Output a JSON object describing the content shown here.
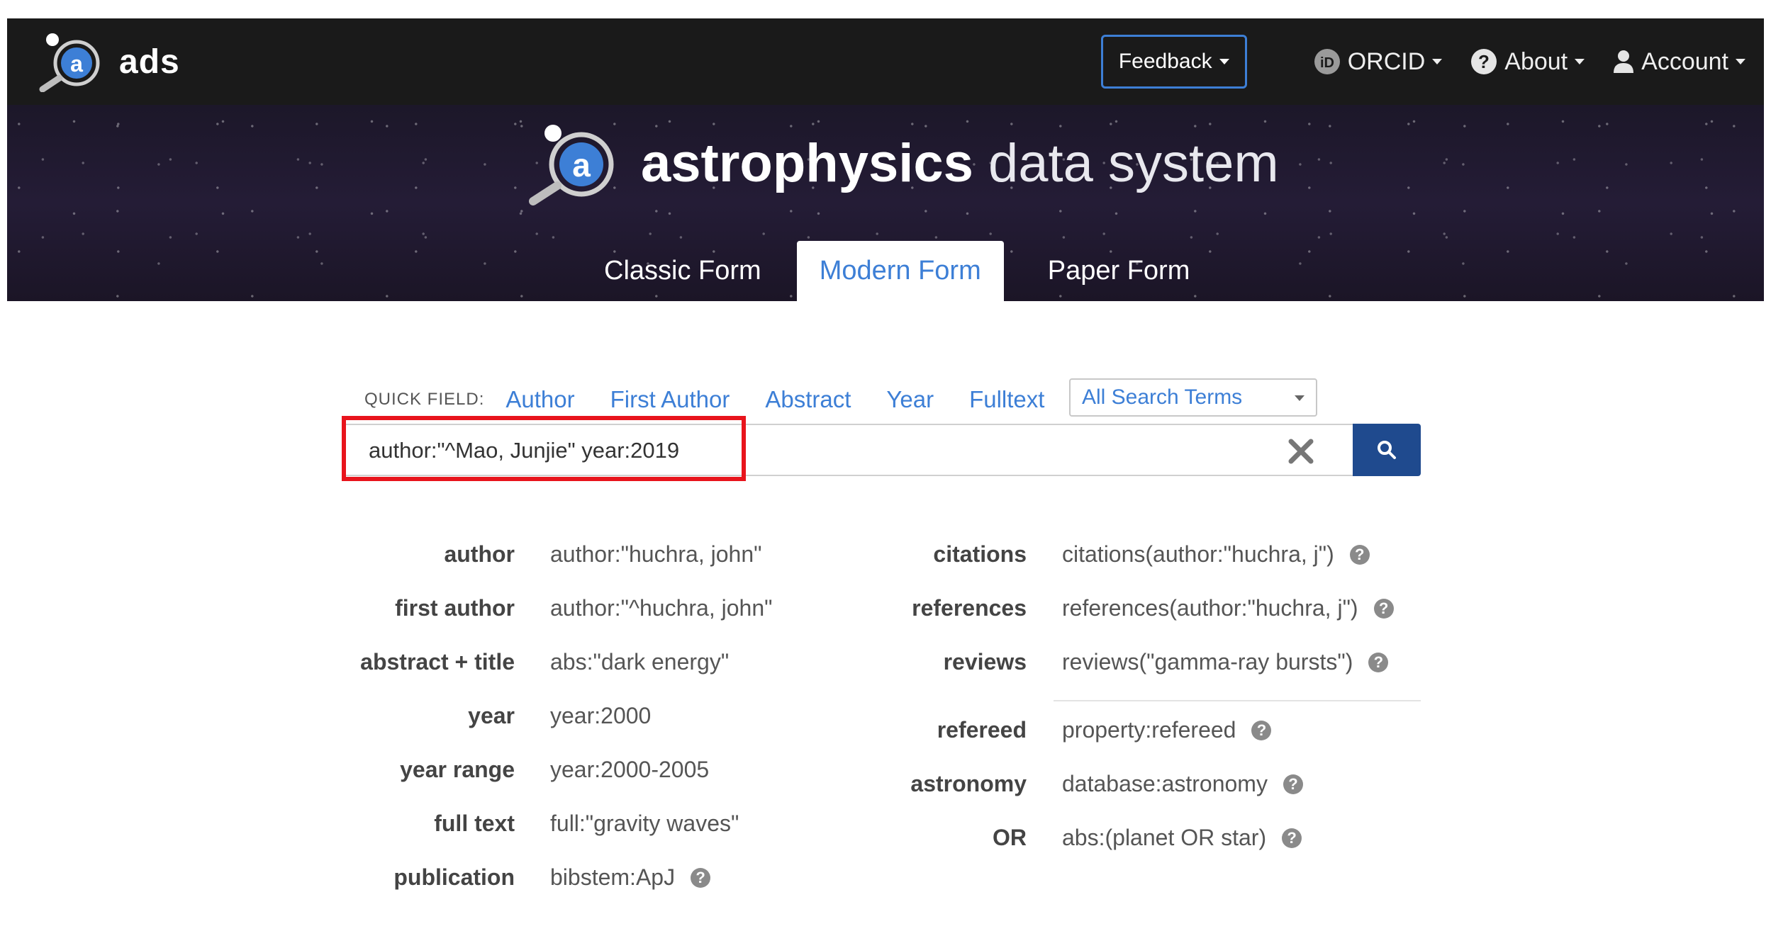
{
  "navbar": {
    "brand": "ads",
    "feedback": "Feedback",
    "orcid": "ORCID",
    "about": "About",
    "account": "Account"
  },
  "hero": {
    "title_bold": "astrophysics",
    "title_light": "data system",
    "tabs": [
      {
        "label": "Classic Form",
        "active": false
      },
      {
        "label": "Modern Form",
        "active": true
      },
      {
        "label": "Paper Form",
        "active": false
      }
    ]
  },
  "quick_field": {
    "label": "QUICK FIELD:",
    "links": [
      "Author",
      "First Author",
      "Abstract",
      "Year",
      "Fulltext"
    ],
    "select_value": "All Search Terms"
  },
  "search": {
    "value": "author:\"^Mao, Junjie\" year:2019"
  },
  "examples_left": [
    {
      "label": "author",
      "value": "author:\"huchra, john\""
    },
    {
      "label": "first author",
      "value": "author:\"^huchra, john\""
    },
    {
      "label": "abstract + title",
      "value": "abs:\"dark energy\""
    },
    {
      "label": "year",
      "value": "year:2000"
    },
    {
      "label": "year range",
      "value": "year:2000-2005"
    },
    {
      "label": "full text",
      "value": "full:\"gravity waves\""
    },
    {
      "label": "publication",
      "value": "bibstem:ApJ"
    }
  ],
  "examples_right": [
    {
      "label": "citations",
      "value": "citations(author:\"huchra, j\")"
    },
    {
      "label": "references",
      "value": "references(author:\"huchra, j\")"
    },
    {
      "label": "reviews",
      "value": "reviews(\"gamma-ray bursts\")"
    },
    {
      "label": "refereed",
      "value": "property:refereed"
    },
    {
      "label": "astronomy",
      "value": "database:astronomy"
    },
    {
      "label": "OR",
      "value": "abs:(planet OR star)"
    }
  ],
  "colors": {
    "accent": "#3d7fd6",
    "navbar_bg": "#1a1a1a",
    "search_button": "#1f4a8e",
    "highlight": "#e8141c"
  }
}
